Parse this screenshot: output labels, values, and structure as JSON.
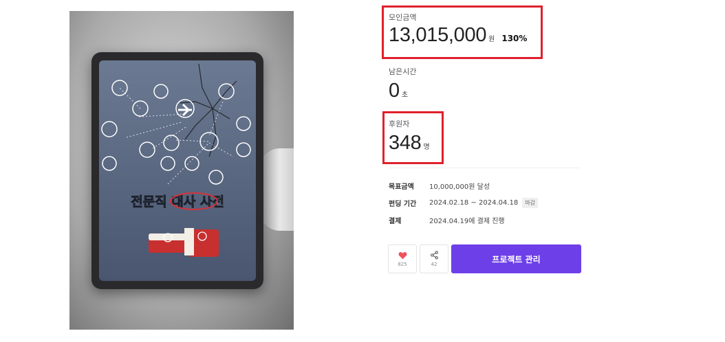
{
  "project": {
    "cover_title": "전문직 대사 사전"
  },
  "funding": {
    "raised_label": "모인금액",
    "raised_value": "13,015,000",
    "raised_unit": "원",
    "raised_percent": "130%",
    "time_label": "남은시간",
    "time_value": "0",
    "time_unit": "초",
    "backers_label": "후원자",
    "backers_value": "348",
    "backers_unit": "명"
  },
  "details": {
    "goal_label": "목표금액",
    "goal_value": "10,000,000원 달성",
    "period_label": "펀딩 기간",
    "period_value": "2024.02.18 ~ 2024.04.18",
    "period_badge": "마감",
    "payment_label": "결제",
    "payment_value": "2024.04.19에 결제 진행"
  },
  "actions": {
    "like_count": "825",
    "share_count": "42",
    "manage_label": "프로젝트 관리"
  },
  "colors": {
    "highlight": "#e0202c",
    "primary_button": "#6d3fe8",
    "heart": "#f0525a"
  }
}
